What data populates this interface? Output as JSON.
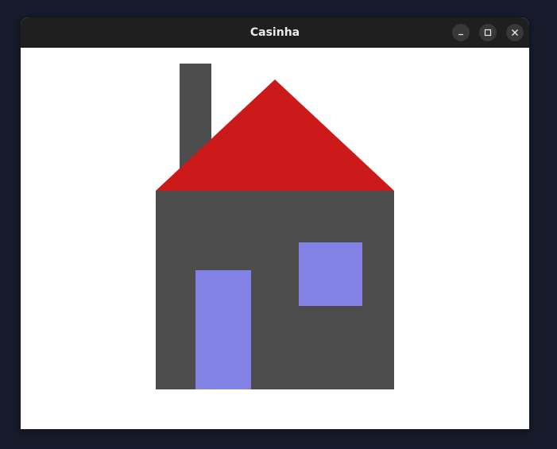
{
  "window": {
    "title": "Casinha"
  },
  "titlebar_buttons": {
    "minimize_icon": "minimize-icon",
    "maximize_icon": "maximize-icon",
    "close_icon": "close-icon"
  },
  "drawing": {
    "background": "#ffffff",
    "house_wall_color": "#4d4d4d",
    "roof_color": "#cc1a1a",
    "chimney_color": "#4d4d4d",
    "door_color": "#8282e6",
    "window_color": "#8282e6"
  }
}
